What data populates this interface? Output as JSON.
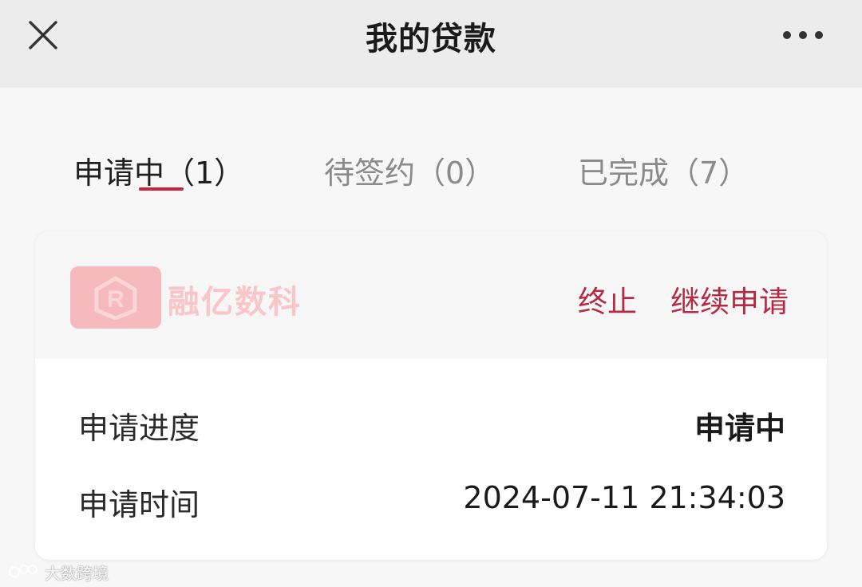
{
  "navbar": {
    "title": "我的贷款",
    "close_icon": "close-icon",
    "more_icon": "more-horizontal-icon"
  },
  "tabs": [
    {
      "label": "申请中（1）",
      "active": true
    },
    {
      "label": "待签约（0）",
      "active": false
    },
    {
      "label": "已完成（7）",
      "active": false
    }
  ],
  "card": {
    "watermark_text": "融亿数科",
    "actions": {
      "terminate": "终止",
      "continue": "继续申请"
    },
    "rows": [
      {
        "label": "申请进度",
        "value": "申请中"
      },
      {
        "label": "申请时间",
        "value": "2024-07-11 21:34:03"
      }
    ]
  },
  "footer_watermark": "大数跨境",
  "colors": {
    "accent": "#c9243f",
    "action_text": "#b52a43",
    "navbar_bg": "#ececec"
  }
}
